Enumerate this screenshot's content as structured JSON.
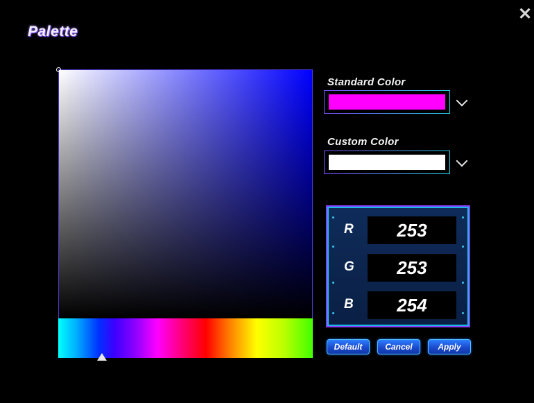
{
  "window": {
    "title": "Palette",
    "close_icon": "close-icon"
  },
  "picker": {
    "hue_color": "#0000ff",
    "saturation_handle": "top-left",
    "hue_handle_icon": "triangle-up-icon"
  },
  "standard_color": {
    "label": "Standard Color",
    "value": "#ff00ff",
    "dropdown_icon": "chevron-down-icon"
  },
  "custom_color": {
    "label": "Custom Color",
    "value": "#ffffff",
    "dropdown_icon": "chevron-down-icon"
  },
  "rgb": {
    "r": {
      "label": "R",
      "value": "253"
    },
    "g": {
      "label": "G",
      "value": "253"
    },
    "b": {
      "label": "B",
      "value": "254"
    }
  },
  "buttons": {
    "default": "Default",
    "cancel": "Cancel",
    "apply": "Apply"
  }
}
